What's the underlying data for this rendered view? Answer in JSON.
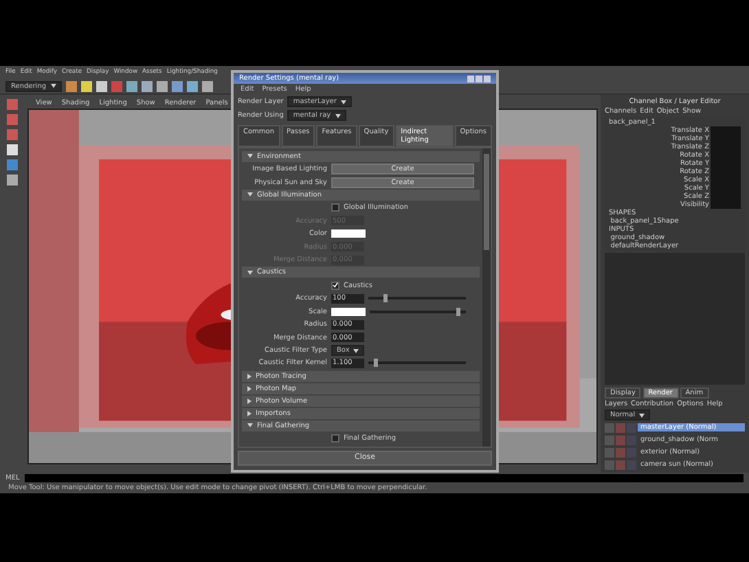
{
  "menu": [
    "File",
    "Edit",
    "Modify",
    "Create",
    "Display",
    "Window",
    "Assets",
    "Lighting/Shading"
  ],
  "mode": "Rendering",
  "viewport": {
    "menu": [
      "View",
      "Shading",
      "Lighting",
      "Show",
      "Renderer",
      "Panels"
    ]
  },
  "dialog": {
    "title": "Render Settings (mental ray)",
    "menu": [
      "Edit",
      "Presets",
      "Help"
    ],
    "fields": [
      {
        "label": "Render Layer",
        "value": "masterLayer"
      },
      {
        "label": "Render Using",
        "value": "mental ray"
      }
    ],
    "tabs": [
      {
        "label": "Common",
        "selected": false
      },
      {
        "label": "Passes",
        "selected": false
      },
      {
        "label": "Features",
        "selected": false
      },
      {
        "label": "Quality",
        "selected": false
      },
      {
        "label": "Indirect Lighting",
        "selected": true
      },
      {
        "label": "Options",
        "selected": false
      }
    ],
    "sections": [
      {
        "title": "Environment",
        "expanded": true,
        "rows": [
          {
            "kind": "button",
            "label": "Image Based Lighting",
            "button": "Create"
          },
          {
            "kind": "button",
            "label": "Physical Sun and Sky",
            "button": "Create"
          }
        ]
      },
      {
        "title": "Global Illumination",
        "expanded": true,
        "rows": [
          {
            "kind": "checkbox",
            "label": "Global Illumination",
            "checked": false
          },
          {
            "kind": "number",
            "label": "Accuracy",
            "value": "500",
            "disabled": true
          },
          {
            "kind": "color",
            "label": "Color",
            "disabled": false
          },
          {
            "kind": "number",
            "label": "Radius",
            "value": "0.000",
            "disabled": true
          },
          {
            "kind": "number",
            "label": "Merge Distance",
            "value": "0.000",
            "disabled": true
          }
        ]
      },
      {
        "title": "Caustics",
        "expanded": true,
        "rows": [
          {
            "kind": "checkbox",
            "label": "Caustics",
            "checked": true
          },
          {
            "kind": "slider",
            "label": "Accuracy",
            "value": "100",
            "level": 0.15,
            "disabled": false
          },
          {
            "kind": "color",
            "label": "Scale",
            "level": 0.9,
            "disabled": false
          },
          {
            "kind": "number",
            "label": "Radius",
            "value": "0.000",
            "disabled": false
          },
          {
            "kind": "number",
            "label": "Merge Distance",
            "value": "0.000",
            "disabled": false
          },
          {
            "kind": "select",
            "label": "Caustic Filter Type",
            "value": "Box"
          },
          {
            "kind": "slider",
            "label": "Caustic Filter Kernel",
            "value": "1.100",
            "level": 0.05,
            "disabled": false
          }
        ]
      },
      {
        "title": "Photon Tracing",
        "expanded": false
      },
      {
        "title": "Photon Map",
        "expanded": false
      },
      {
        "title": "Photon Volume",
        "expanded": false
      },
      {
        "title": "Importons",
        "expanded": false
      },
      {
        "title": "Final Gathering",
        "expanded": true,
        "rows": [
          {
            "kind": "checkbox",
            "label": "Final Gathering",
            "checked": false
          }
        ]
      }
    ],
    "close": "Close"
  },
  "channel_box": {
    "title": "Channel Box / Layer Editor",
    "menu": [
      "Channels",
      "Edit",
      "Object",
      "Show"
    ],
    "object": "back_panel_1",
    "attributes": [
      "Translate X",
      "Translate Y",
      "Translate Z",
      "Rotate X",
      "Rotate Y",
      "Rotate Z",
      "Scale X",
      "Scale Y",
      "Scale Z",
      "Visibility"
    ],
    "shapes_header": "SHAPES",
    "shapes": [
      "back_panel_1Shape"
    ],
    "inputs_header": "INPUTS",
    "inputs": [
      "ground_shadow",
      "defaultRenderLayer"
    ]
  },
  "layer_editor": {
    "tabs": [
      {
        "label": "Display",
        "selected": false
      },
      {
        "label": "Render",
        "selected": true
      },
      {
        "label": "Anim",
        "selected": false
      }
    ],
    "menu": [
      "Layers",
      "Contribution",
      "Options",
      "Help"
    ],
    "blend": "Normal",
    "layers": [
      {
        "name": "masterLayer (Normal)",
        "selected": true
      },
      {
        "name": "ground_shadow (Norm",
        "selected": false
      },
      {
        "name": "exterior (Normal)",
        "selected": false
      },
      {
        "name": "camera sun (Normal)",
        "selected": false
      }
    ]
  },
  "command_label": "MEL",
  "help_line": "Move Tool: Use manipulator to move object(s). Use edit mode to change pivot (INSERT). Ctrl+LMB to move perpendicular."
}
